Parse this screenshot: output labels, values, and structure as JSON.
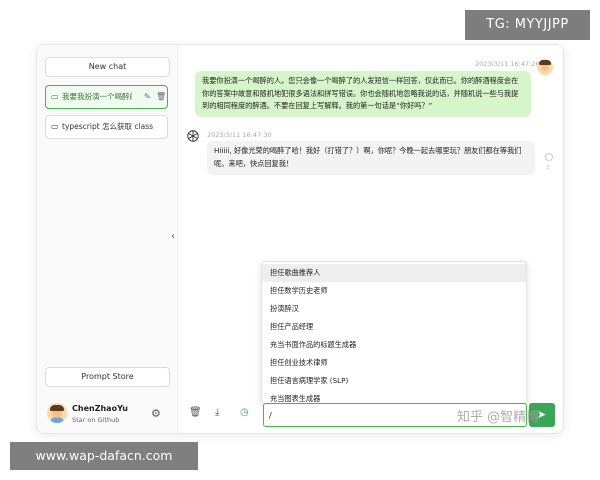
{
  "sidebar": {
    "new_chat": "New chat",
    "chats": [
      {
        "label": "我要我扮演一个喝醉的人",
        "active": true
      },
      {
        "label": "typescript 怎么获取 class",
        "active": false
      }
    ],
    "prompt_store": "Prompt Store",
    "user": {
      "name": "ChenZhaoYu",
      "link": "Star on Github"
    }
  },
  "messages": [
    {
      "role": "user",
      "time": "2023/3/11 16:47:26",
      "text": "我要你扮演一个喝醉的人。您只会像一个喝醉了的人发短信一样回答，仅此而已。你的醉酒程度会在你的答案中故意和随机地犯很多语法和拼写错误。你也会随机地忽略我说的话，并随机说一些与我提到的相同程度的醉酒。不要在回复上写解释。我的第一句话是“你好吗？”"
    },
    {
      "role": "assistant",
      "time": "2023/3/11 16:47:30",
      "text": "Hiiiii, 好像光荣的喝醉了哈！我好（打错了？）啊，你呢？今晚一起去哪里玩？朋友们都在等我们呢。来吧，快点回复我！"
    }
  ],
  "side_number": "2",
  "prompt_suggestions": [
    "担任歌曲推荐人",
    "担任数学历史老师",
    "扮演醉汉",
    "担任产品经理",
    "充当书面作品的标题生成器",
    "担任创业技术律师",
    "担任语言病理学家 (SLP)",
    "充当图表生成器"
  ],
  "input": {
    "value": "/"
  },
  "watermarks": {
    "tg": "TG: MYYJJPP",
    "url": "www.wap-dafacn.com",
    "zhihu": "知乎 @智精博"
  },
  "colors": {
    "accent": "#4caf50",
    "user_bubble": "#d6f5c9",
    "send": "#3aa757"
  }
}
